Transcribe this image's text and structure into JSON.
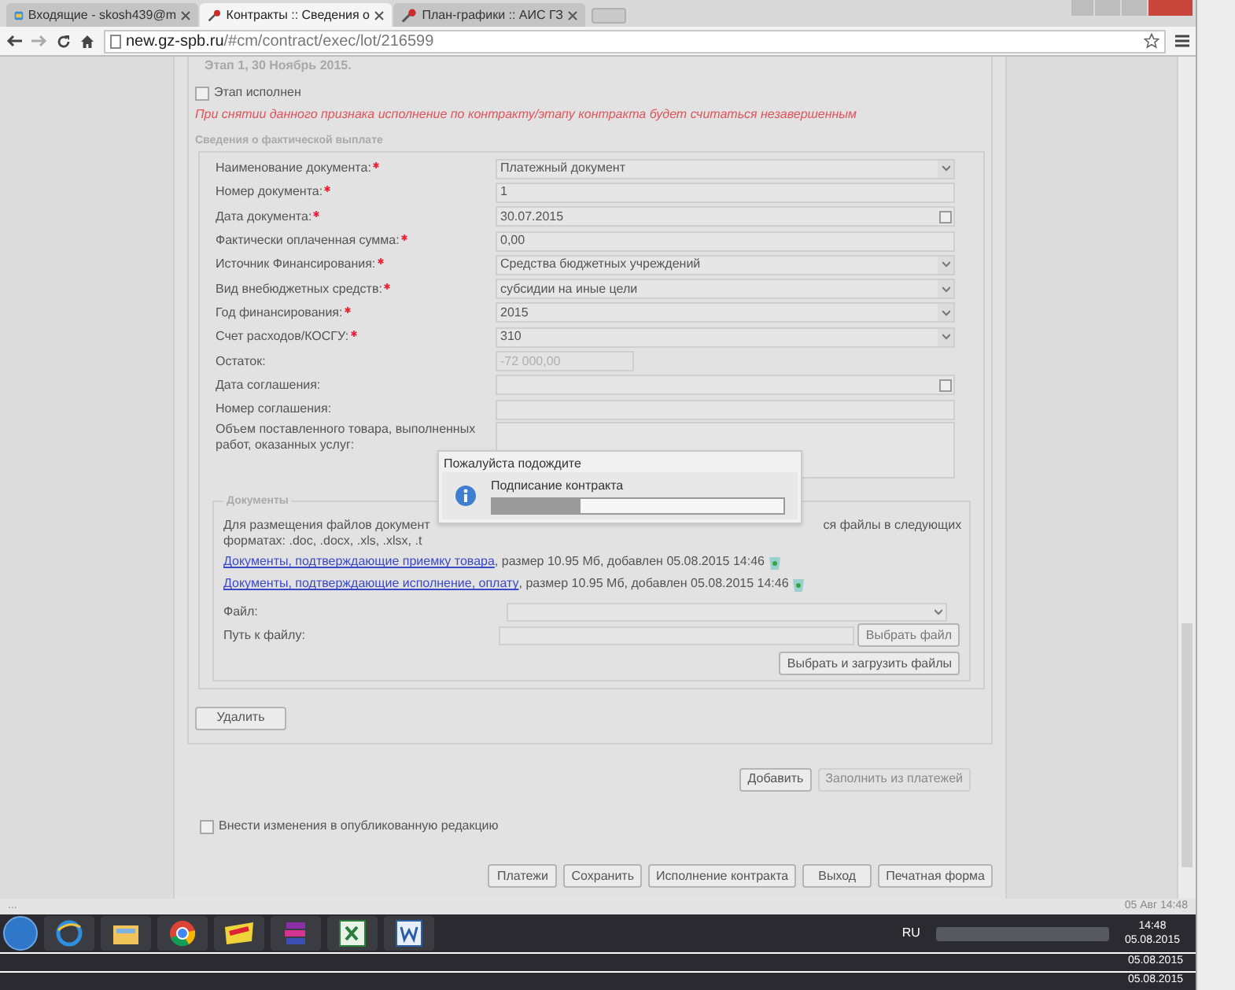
{
  "browser": {
    "tabs": [
      {
        "title": "Входящие - skosh439@m",
        "selected": false
      },
      {
        "title": "Контракты :: Сведения о",
        "selected": true
      },
      {
        "title": "План-графики :: АИС ГЗ",
        "selected": false
      }
    ],
    "url_host": "new.gz-spb.ru",
    "url_path": "/#cm/contract/exec/lot/216599"
  },
  "stage": {
    "legend": "Этап 1, 30 Ноябрь 2015.",
    "checkbox": {
      "label": "Этап исполнен",
      "checked": false
    },
    "warning": "При снятии данного признака исполнение по контракту/этапу контракта будет считаться незавершенным"
  },
  "payment": {
    "legend": "Сведения о фактической выплате",
    "fields": [
      {
        "label": "Наименование документа:",
        "required": true,
        "kind": "select",
        "value": "Платежный документ"
      },
      {
        "label": "Номер документа:",
        "required": true,
        "kind": "text",
        "value": "1"
      },
      {
        "label": "Дата документа:",
        "required": true,
        "kind": "date",
        "value": "30.07.2015"
      },
      {
        "label": "Фактически оплаченная сумма:",
        "required": true,
        "kind": "text",
        "value": "0,00"
      },
      {
        "label": "Источник Финансирования:",
        "required": true,
        "kind": "select",
        "value": "Средства бюджетных учреждений"
      },
      {
        "label": "Вид внебюджетных средств:",
        "required": true,
        "kind": "select",
        "value": "субсидии на иные цели"
      },
      {
        "label": "Год финансирования:",
        "required": true,
        "kind": "select",
        "value": "2015"
      },
      {
        "label": "Счет расходов/КОСГУ:",
        "required": true,
        "kind": "select",
        "value": "310"
      },
      {
        "label": "Остаток:",
        "required": false,
        "kind": "disabled",
        "value": "-72 000,00"
      },
      {
        "label": "Дата соглашения:",
        "required": false,
        "kind": "date"
      },
      {
        "label": "Номер соглашения:",
        "required": false,
        "kind": "text"
      },
      {
        "label": "Объем поставленного товара, выполненных работ, оказанных услуг:",
        "required": false,
        "kind": "textarea"
      }
    ]
  },
  "documents": {
    "legend": "Документы",
    "info_left": "Для размещения файлов документ",
    "info_right": "ся файлы в следующих",
    "info_line_2": "форматах: .doc, .docx, .xls, .xlsx, .t",
    "files": [
      {
        "link": "Документы, подтверждающие приемку товара",
        "meta": ", размер 10.95 Мб, добавлен 05.08.2015 14:46"
      },
      {
        "link": "Документы, подтверждающие исполнение, оплату",
        "meta": ", размер 10.95 Мб, добавлен 05.08.2015 14:46"
      }
    ],
    "file_label": "Файл:",
    "path_label": "Путь к файлу:",
    "choose_button": "Выбрать файл",
    "upload_button": "Выбрать и загрузить файлы"
  },
  "delete_button": "Удалить",
  "actions": [
    {
      "label": "Добавить",
      "disabled": false
    },
    {
      "label": "Заполнить из платежей",
      "disabled": true
    }
  ],
  "publish_checkbox": {
    "label": "Внести изменения в опубликованную редакцию",
    "checked": false
  },
  "footer_buttons": [
    "Платежи",
    "Сохранить",
    "Исполнение контракта",
    "Выход",
    "Печатная форма"
  ],
  "dialog": {
    "title": "Пожалуйста подождите",
    "message": "Подписание контракта",
    "level": 0.3
  },
  "status_bar": {
    "left": "...",
    "right": "05 Авг 14:48"
  },
  "taskbar": {
    "language": "RU",
    "time": "14:48",
    "date": "05.08.2015"
  },
  "ghost_dates": [
    "05.08.2015",
    "05.08.2015"
  ]
}
